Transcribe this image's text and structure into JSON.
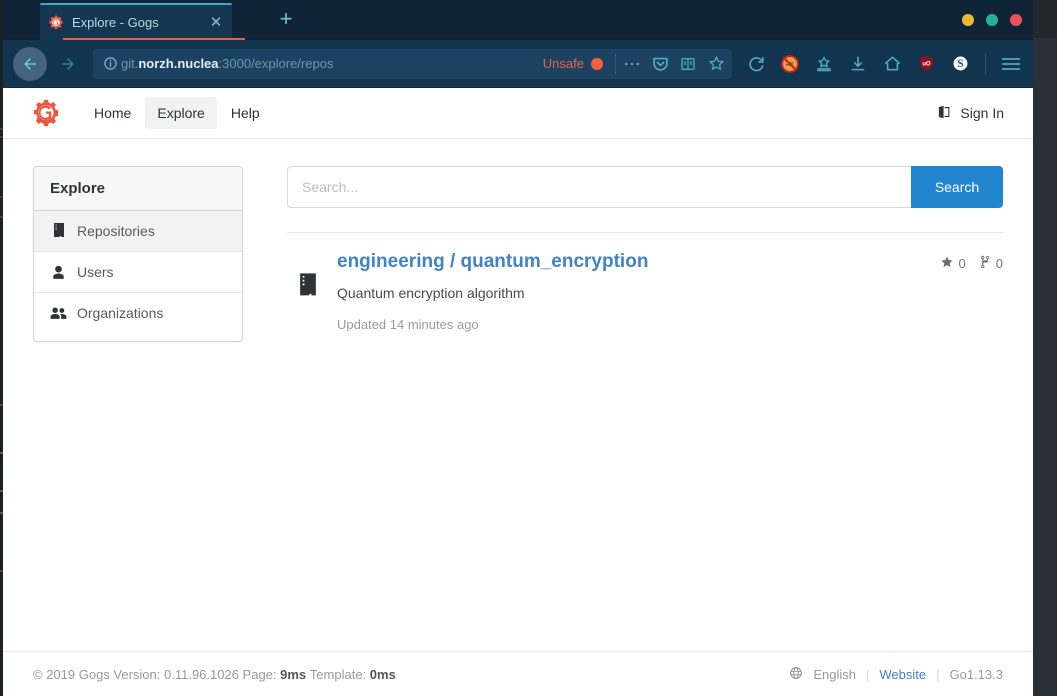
{
  "window": {
    "controls": [
      {
        "name": "minimize",
        "color": "#e8b931"
      },
      {
        "name": "maximize",
        "color": "#25b09b"
      },
      {
        "name": "close",
        "color": "#e8515f"
      }
    ]
  },
  "browser": {
    "tab": {
      "title": "Explore - Gogs",
      "favicon": "gogs-favicon",
      "close_label": "✕"
    },
    "new_tab_label": "+",
    "nav": {
      "back": "back-arrow",
      "forward": "forward-arrow"
    },
    "url": {
      "prefix": "git.",
      "host": "norzh.nuclea",
      "suffix": ":3000/explore/repos",
      "security_label": "Unsafe",
      "info_icon": "info-icon"
    },
    "url_actions": [
      {
        "name": "page-actions-icon",
        "glyph": "•••"
      },
      {
        "name": "pocket-icon",
        "glyph": "shield"
      },
      {
        "name": "reader-view-icon",
        "glyph": "reader"
      },
      {
        "name": "bookmark-star-icon",
        "glyph": "star"
      }
    ],
    "toolbar_icons": [
      {
        "name": "reload-icon"
      },
      {
        "name": "noscript-icon"
      },
      {
        "name": "save-to-pocket-icon"
      },
      {
        "name": "downloads-icon"
      },
      {
        "name": "home-icon"
      },
      {
        "name": "ublock-origin-icon",
        "label": "uO"
      },
      {
        "name": "sync-icon",
        "label": "S"
      },
      {
        "name": "menu-icon"
      }
    ]
  },
  "gogs": {
    "logo": "gogs-gear-logo",
    "nav": [
      {
        "label": "Home",
        "active": false,
        "name": "nav-home"
      },
      {
        "label": "Explore",
        "active": true,
        "name": "nav-explore"
      },
      {
        "label": "Help",
        "active": false,
        "name": "nav-help"
      }
    ],
    "signin": {
      "label": "Sign In",
      "icon": "sign-in-icon"
    },
    "sidebar": {
      "title": "Explore",
      "items": [
        {
          "label": "Repositories",
          "icon": "repo-book-icon",
          "active": true
        },
        {
          "label": "Users",
          "icon": "user-icon",
          "active": false
        },
        {
          "label": "Organizations",
          "icon": "users-group-icon",
          "active": false
        }
      ]
    },
    "search": {
      "placeholder": "Search...",
      "value": "",
      "button_label": "Search"
    },
    "repositories": [
      {
        "owner": "engineering",
        "name": "quantum_encryption",
        "full_name": "engineering / quantum_encryption",
        "description": "Quantum encryption algorithm",
        "updated": "Updated 14 minutes ago",
        "stars": "0",
        "forks": "0",
        "icon": "repo-book-icon"
      }
    ],
    "footer": {
      "copyright": "© 2019 Gogs Version: 0.11.96.1026 Page:",
      "page_time": "9ms",
      "template_label": "Template:",
      "template_time": "0ms",
      "language": "English",
      "language_icon": "globe-icon",
      "website_label": "Website",
      "go_version": "Go1.13.3",
      "separator": "|"
    }
  },
  "colors": {
    "accent_blue": "#2185d0",
    "link_blue": "#4183c4",
    "gogs_red": "#e8573f",
    "unsafe_orange": "#f4603c",
    "tab_accent": "#2cb5c0"
  }
}
